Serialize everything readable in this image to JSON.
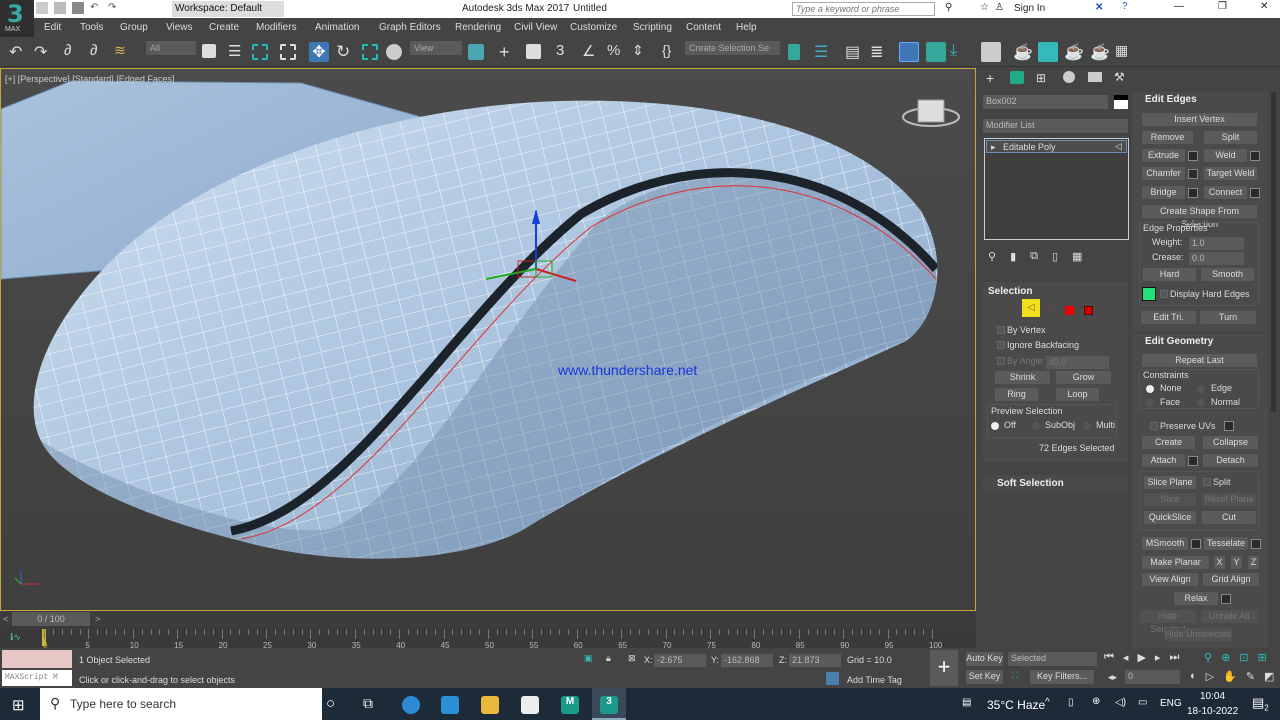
{
  "app": {
    "title": "Autodesk 3ds Max 2017",
    "file": "Untitled",
    "logo": "3",
    "logo_sub": "MAX",
    "workspace": "Workspace: Default",
    "search_placeholder": "Type a keyword or phrase",
    "sign_in": "Sign In"
  },
  "menu": [
    "Edit",
    "Tools",
    "Group",
    "Views",
    "Create",
    "Modifiers",
    "Animation",
    "Graph Editors",
    "Rendering",
    "Civil View",
    "Customize",
    "Scripting",
    "Content",
    "Help"
  ],
  "toolbar": {
    "filter": "All",
    "ref_coord": "View",
    "selection_set": "Create Selection Se"
  },
  "viewport": {
    "label": "[+] [Perspective] [Standard] [Edged Faces]",
    "watermark": "www.thundershare.net"
  },
  "panel": {
    "object_name": "Box002",
    "modifier_list": "Modifier List",
    "stack_item": "Editable Poly",
    "selection": {
      "title": "Selection",
      "by_vertex": "By Vertex",
      "ignore_backfacing": "Ignore Backfacing",
      "by_angle": "By Angle:",
      "angle": "45.0",
      "shrink": "Shrink",
      "grow": "Grow",
      "ring": "Ring",
      "loop": "Loop",
      "preview": "Preview Selection",
      "off": "Off",
      "subobj": "SubObj",
      "multi": "Multi",
      "count": "72 Edges Selected"
    },
    "soft_selection": "Soft Selection",
    "edit_edges": {
      "title": "Edit Edges",
      "insert_vertex": "Insert Vertex",
      "remove": "Remove",
      "split": "Split",
      "extrude": "Extrude",
      "weld": "Weld",
      "chamfer": "Chamfer",
      "target_weld": "Target Weld",
      "bridge": "Bridge",
      "connect": "Connect",
      "create_shape": "Create Shape From Selection",
      "edge_props": "Edge Properties",
      "weight_label": "Weight:",
      "weight": "1.0",
      "crease_label": "Crease:",
      "crease": "0.0",
      "hard": "Hard",
      "smooth": "Smooth",
      "display_hard": "Display Hard Edges",
      "hard_color": "#22e07a",
      "edit_tri": "Edit Tri.",
      "turn": "Turn"
    },
    "edit_geometry": {
      "title": "Edit Geometry",
      "repeat_last": "Repeat Last",
      "constraints": "Constraints",
      "none": "None",
      "edge": "Edge",
      "face": "Face",
      "normal": "Normal",
      "preserve_uvs": "Preserve UVs",
      "create": "Create",
      "collapse": "Collapse",
      "attach": "Attach",
      "detach": "Detach",
      "slice_plane": "Slice Plane",
      "split": "Split",
      "slice": "Slice",
      "reset_plane": "Reset Plane",
      "quickslice": "QuickSlice",
      "cut": "Cut",
      "msmooth": "MSmooth",
      "tesselate": "Tesselate",
      "make_planar": "Make Planar",
      "x": "X",
      "y": "Y",
      "z": "Z",
      "view_align": "View Align",
      "grid_align": "Grid Align",
      "relax": "Relax",
      "hide_selected": "Hide Selected",
      "unhide_all": "Unhide All",
      "hide_unselected": "Hide Unselected"
    }
  },
  "timeline": {
    "frame": "0 / 100",
    "prev": "<",
    "next": ">",
    "ticks": [
      "5",
      "10",
      "15",
      "20",
      "25",
      "30",
      "35",
      "40",
      "45",
      "50",
      "55",
      "60",
      "65",
      "70",
      "75",
      "80",
      "85",
      "90",
      "95",
      "100"
    ],
    "start": "0"
  },
  "status": {
    "selected": "1 Object Selected",
    "prompt": "Click or click-and-drag to select objects",
    "maxscript": "MAXScript M",
    "x_label": "X:",
    "x": "-2.675",
    "y_label": "Y:",
    "y": "-162.868",
    "z_label": "Z:",
    "z": "21.873",
    "grid": "Grid = 10.0",
    "time_tag": "Add Time Tag",
    "auto_key": "Auto Key",
    "set_key": "Set Key",
    "key_mode": "Selected",
    "key_filters": "Key Filters...",
    "current_frame": "0"
  },
  "taskbar": {
    "search": "Type here to search",
    "weather": "35°C  Haze",
    "lang": "ENG",
    "time": "10:04",
    "date": "18-10-2022",
    "notifications": "2"
  }
}
